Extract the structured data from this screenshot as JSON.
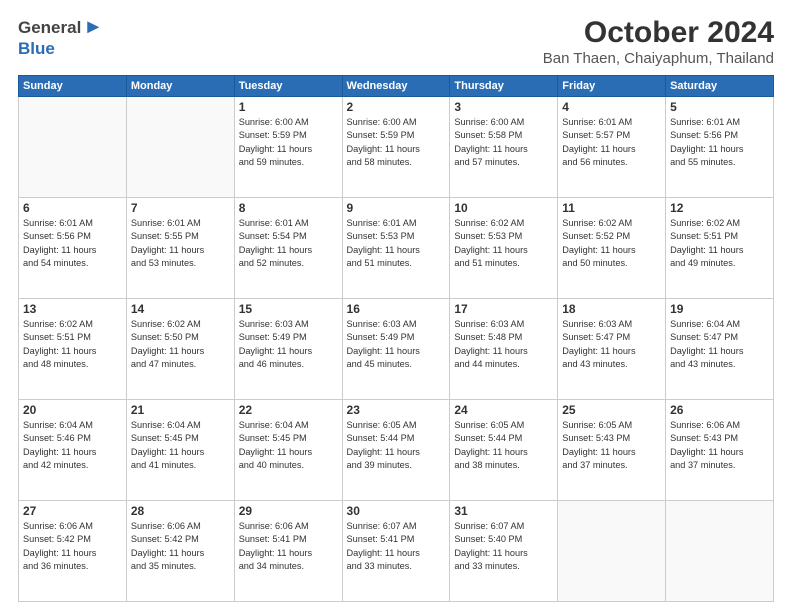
{
  "header": {
    "logo_general": "General",
    "logo_blue": "Blue",
    "title": "October 2024",
    "subtitle": "Ban Thaen, Chaiyaphum, Thailand"
  },
  "weekdays": [
    "Sunday",
    "Monday",
    "Tuesday",
    "Wednesday",
    "Thursday",
    "Friday",
    "Saturday"
  ],
  "weeks": [
    [
      {
        "day": "",
        "info": ""
      },
      {
        "day": "",
        "info": ""
      },
      {
        "day": "1",
        "info": "Sunrise: 6:00 AM\nSunset: 5:59 PM\nDaylight: 11 hours\nand 59 minutes."
      },
      {
        "day": "2",
        "info": "Sunrise: 6:00 AM\nSunset: 5:59 PM\nDaylight: 11 hours\nand 58 minutes."
      },
      {
        "day": "3",
        "info": "Sunrise: 6:00 AM\nSunset: 5:58 PM\nDaylight: 11 hours\nand 57 minutes."
      },
      {
        "day": "4",
        "info": "Sunrise: 6:01 AM\nSunset: 5:57 PM\nDaylight: 11 hours\nand 56 minutes."
      },
      {
        "day": "5",
        "info": "Sunrise: 6:01 AM\nSunset: 5:56 PM\nDaylight: 11 hours\nand 55 minutes."
      }
    ],
    [
      {
        "day": "6",
        "info": "Sunrise: 6:01 AM\nSunset: 5:56 PM\nDaylight: 11 hours\nand 54 minutes."
      },
      {
        "day": "7",
        "info": "Sunrise: 6:01 AM\nSunset: 5:55 PM\nDaylight: 11 hours\nand 53 minutes."
      },
      {
        "day": "8",
        "info": "Sunrise: 6:01 AM\nSunset: 5:54 PM\nDaylight: 11 hours\nand 52 minutes."
      },
      {
        "day": "9",
        "info": "Sunrise: 6:01 AM\nSunset: 5:53 PM\nDaylight: 11 hours\nand 51 minutes."
      },
      {
        "day": "10",
        "info": "Sunrise: 6:02 AM\nSunset: 5:53 PM\nDaylight: 11 hours\nand 51 minutes."
      },
      {
        "day": "11",
        "info": "Sunrise: 6:02 AM\nSunset: 5:52 PM\nDaylight: 11 hours\nand 50 minutes."
      },
      {
        "day": "12",
        "info": "Sunrise: 6:02 AM\nSunset: 5:51 PM\nDaylight: 11 hours\nand 49 minutes."
      }
    ],
    [
      {
        "day": "13",
        "info": "Sunrise: 6:02 AM\nSunset: 5:51 PM\nDaylight: 11 hours\nand 48 minutes."
      },
      {
        "day": "14",
        "info": "Sunrise: 6:02 AM\nSunset: 5:50 PM\nDaylight: 11 hours\nand 47 minutes."
      },
      {
        "day": "15",
        "info": "Sunrise: 6:03 AM\nSunset: 5:49 PM\nDaylight: 11 hours\nand 46 minutes."
      },
      {
        "day": "16",
        "info": "Sunrise: 6:03 AM\nSunset: 5:49 PM\nDaylight: 11 hours\nand 45 minutes."
      },
      {
        "day": "17",
        "info": "Sunrise: 6:03 AM\nSunset: 5:48 PM\nDaylight: 11 hours\nand 44 minutes."
      },
      {
        "day": "18",
        "info": "Sunrise: 6:03 AM\nSunset: 5:47 PM\nDaylight: 11 hours\nand 43 minutes."
      },
      {
        "day": "19",
        "info": "Sunrise: 6:04 AM\nSunset: 5:47 PM\nDaylight: 11 hours\nand 43 minutes."
      }
    ],
    [
      {
        "day": "20",
        "info": "Sunrise: 6:04 AM\nSunset: 5:46 PM\nDaylight: 11 hours\nand 42 minutes."
      },
      {
        "day": "21",
        "info": "Sunrise: 6:04 AM\nSunset: 5:45 PM\nDaylight: 11 hours\nand 41 minutes."
      },
      {
        "day": "22",
        "info": "Sunrise: 6:04 AM\nSunset: 5:45 PM\nDaylight: 11 hours\nand 40 minutes."
      },
      {
        "day": "23",
        "info": "Sunrise: 6:05 AM\nSunset: 5:44 PM\nDaylight: 11 hours\nand 39 minutes."
      },
      {
        "day": "24",
        "info": "Sunrise: 6:05 AM\nSunset: 5:44 PM\nDaylight: 11 hours\nand 38 minutes."
      },
      {
        "day": "25",
        "info": "Sunrise: 6:05 AM\nSunset: 5:43 PM\nDaylight: 11 hours\nand 37 minutes."
      },
      {
        "day": "26",
        "info": "Sunrise: 6:06 AM\nSunset: 5:43 PM\nDaylight: 11 hours\nand 37 minutes."
      }
    ],
    [
      {
        "day": "27",
        "info": "Sunrise: 6:06 AM\nSunset: 5:42 PM\nDaylight: 11 hours\nand 36 minutes."
      },
      {
        "day": "28",
        "info": "Sunrise: 6:06 AM\nSunset: 5:42 PM\nDaylight: 11 hours\nand 35 minutes."
      },
      {
        "day": "29",
        "info": "Sunrise: 6:06 AM\nSunset: 5:41 PM\nDaylight: 11 hours\nand 34 minutes."
      },
      {
        "day": "30",
        "info": "Sunrise: 6:07 AM\nSunset: 5:41 PM\nDaylight: 11 hours\nand 33 minutes."
      },
      {
        "day": "31",
        "info": "Sunrise: 6:07 AM\nSunset: 5:40 PM\nDaylight: 11 hours\nand 33 minutes."
      },
      {
        "day": "",
        "info": ""
      },
      {
        "day": "",
        "info": ""
      }
    ]
  ]
}
